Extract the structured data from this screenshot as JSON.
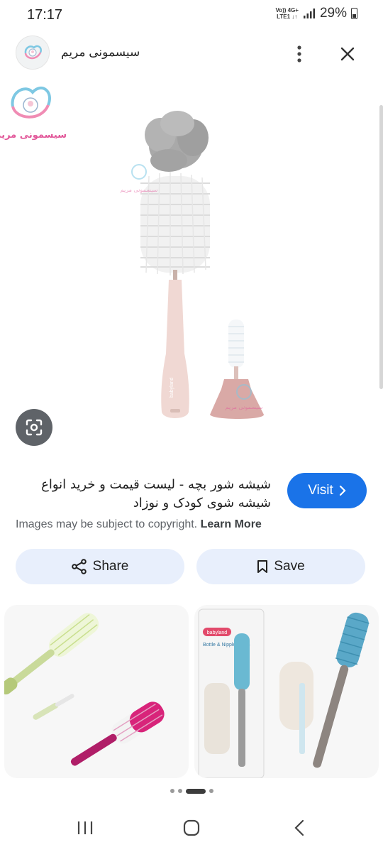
{
  "status_bar": {
    "time": "17:17",
    "network_top": "Vo)) 4G+",
    "network_bottom": "LTE1 ↓↑",
    "battery": "29%"
  },
  "header": {
    "site_name": "سیسمونی مریم",
    "logo_text": "سیسمونی مریم"
  },
  "main_image": {
    "watermark_text": "سیسمونی مریم",
    "brush_handle_text": "babyland"
  },
  "result": {
    "title": "شیشه شور بچه - لیست قیمت و خرید انواع شیشه شوی کودک و نوزاد",
    "visit_label": "Visit",
    "copyright_text": "Images may be subject to copyright.",
    "learn_more_label": "Learn More"
  },
  "actions": {
    "share_label": "Share",
    "save_label": "Save"
  },
  "related": {
    "package_brand": "babyland",
    "package_title": "Bottle & Nipple Brush"
  },
  "pager": {
    "dot_count": 4,
    "active_index": 2
  },
  "colors": {
    "accent": "#1a73e8",
    "action_bg": "#e8effc",
    "lens_bg": "#5f6368"
  }
}
